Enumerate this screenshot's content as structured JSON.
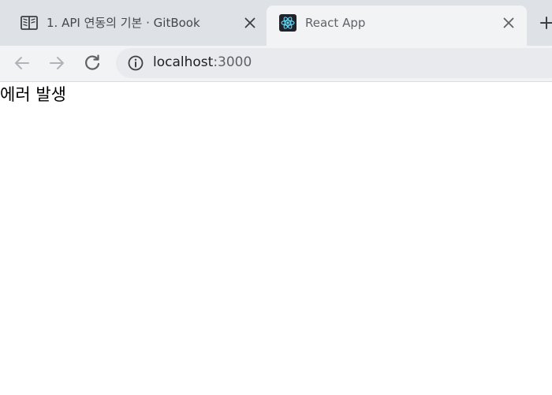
{
  "browser": {
    "tabs": [
      {
        "title": "1. API 연동의 기본 · GitBook",
        "favicon": "open-book-icon",
        "active": false
      },
      {
        "title": "React App",
        "favicon": "react-atom-icon",
        "active": true
      }
    ],
    "new_tab_icon": "plus-icon",
    "toolbar": {
      "back_icon": "arrow-left-icon",
      "forward_icon": "arrow-right-icon",
      "reload_icon": "reload-icon",
      "info_icon": "info-circle-icon",
      "url_host": "localhost",
      "url_port": ":3000"
    },
    "colors": {
      "tabstrip": "#dee1e6",
      "active_tab": "#f1f3f4",
      "omnibox": "#e8eaed",
      "react_bg": "#20232a",
      "react_atom": "#61dafb"
    }
  },
  "page": {
    "body_text": "에러 발생"
  }
}
